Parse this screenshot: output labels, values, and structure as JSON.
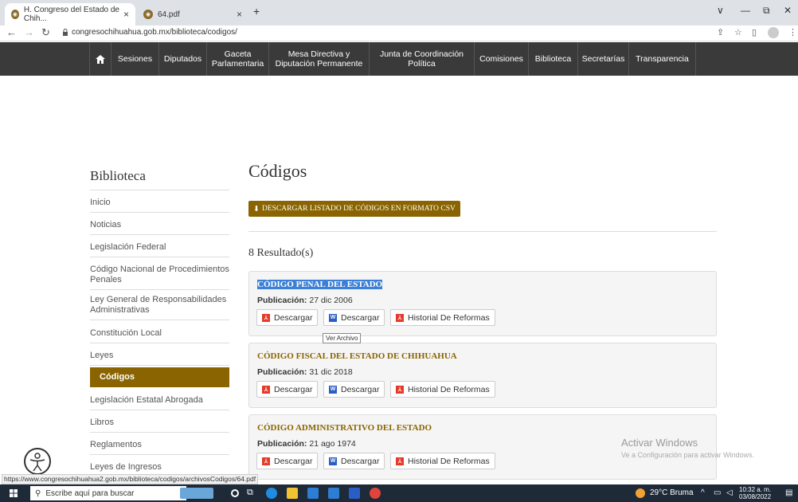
{
  "browser": {
    "tabs": [
      {
        "label": "H. Congreso del Estado de Chih...",
        "close": "×"
      },
      {
        "label": "64.pdf",
        "close": "×"
      }
    ],
    "new_tab": "+",
    "url": "congresochihuahua.gob.mx/biblioteca/codigos/",
    "window_controls": [
      "∨",
      "—",
      "⧉",
      "✕"
    ]
  },
  "nav": {
    "home_icon": "home-icon",
    "items": [
      "Sesiones",
      "Diputados",
      "Gaceta Parlamentaria",
      "Mesa Directiva y Diputación Permanente",
      "Junta de Coordinación Política",
      "Comisiones",
      "Biblioteca",
      "Secretarías",
      "Transparencia"
    ]
  },
  "sidebar": {
    "title": "Biblioteca",
    "items": [
      "Inicio",
      "Noticias",
      "Legislación Federal",
      "Código Nacional de Procedimientos Penales",
      "Ley General de Responsabilidades Administrativas",
      "Constitución Local",
      "Leyes",
      "Códigos",
      "Legislación Estatal Abrogada",
      "Libros",
      "Reglamentos",
      "Leyes de Ingresos"
    ],
    "active": "Códigos"
  },
  "main": {
    "title": "Códigos",
    "csv_button": "DESCARGAR LISTADO DE CÓDIGOS EN FORMATO CSV",
    "results": "8 Resultado(s)",
    "pub_label": "Publicación:",
    "buttons": {
      "pdf": "Descargar",
      "word": "Descargar",
      "history": "Historial De Reformas"
    },
    "cards": [
      {
        "title": "CÓDIGO PENAL DEL ESTADO",
        "date": "27 dic 2006"
      },
      {
        "title": "CÓDIGO FISCAL DEL ESTADO DE CHIHUAHUA",
        "date": "31 dic 2018"
      },
      {
        "title": "CÓDIGO ADMINISTRATIVO DEL ESTADO",
        "date": "21 ago 1974"
      }
    ],
    "tooltip": "Ver Archivo"
  },
  "watermark": {
    "line1": "Activar Windows",
    "line2": "Ve a Configuración para activar Windows."
  },
  "status_url": "https://www.congresochihuahua2.gob.mx/biblioteca/codigos/archivosCodigos/64.pdf",
  "taskbar": {
    "search_placeholder": "Escribe aquí para buscar",
    "weather": "29°C  Bruma",
    "time": "10:32 a. m.",
    "date": "03/08/2022"
  },
  "colors": {
    "accent": "#8a6400",
    "nav_bg": "#3a3a3a",
    "card_title": "#8a6400",
    "pdf_red": "#e53a2a",
    "word_blue": "#2b5ec4"
  }
}
